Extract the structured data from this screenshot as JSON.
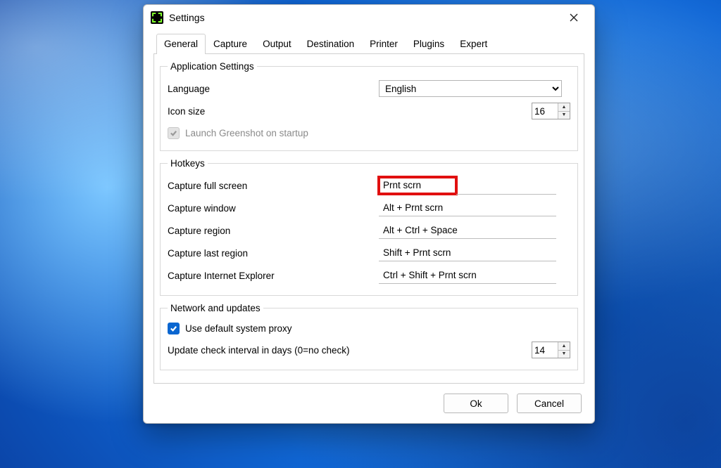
{
  "window": {
    "title": "Settings"
  },
  "tabs": {
    "items": [
      "General",
      "Capture",
      "Output",
      "Destination",
      "Printer",
      "Plugins",
      "Expert"
    ],
    "active_index": 0
  },
  "app_settings": {
    "legend": "Application Settings",
    "language_label": "Language",
    "language_value": "English",
    "icon_size_label": "Icon size",
    "icon_size_value": "16",
    "launch_on_startup_label": "Launch Greenshot on startup",
    "launch_on_startup_checked": true,
    "launch_on_startup_disabled": true
  },
  "hotkeys": {
    "legend": "Hotkeys",
    "rows": [
      {
        "label": "Capture full screen",
        "value": "Prnt scrn",
        "highlight": true
      },
      {
        "label": "Capture window",
        "value": "Alt + Prnt scrn",
        "highlight": false
      },
      {
        "label": "Capture region",
        "value": "Alt + Ctrl + Space",
        "highlight": false
      },
      {
        "label": "Capture last region",
        "value": "Shift + Prnt scrn",
        "highlight": false
      },
      {
        "label": "Capture Internet Explorer",
        "value": "Ctrl + Shift + Prnt scrn",
        "highlight": false
      }
    ]
  },
  "network": {
    "legend": "Network and updates",
    "use_proxy_label": "Use default system proxy",
    "use_proxy_checked": true,
    "update_interval_label": "Update check interval in days (0=no check)",
    "update_interval_value": "14"
  },
  "buttons": {
    "ok": "Ok",
    "cancel": "Cancel"
  }
}
